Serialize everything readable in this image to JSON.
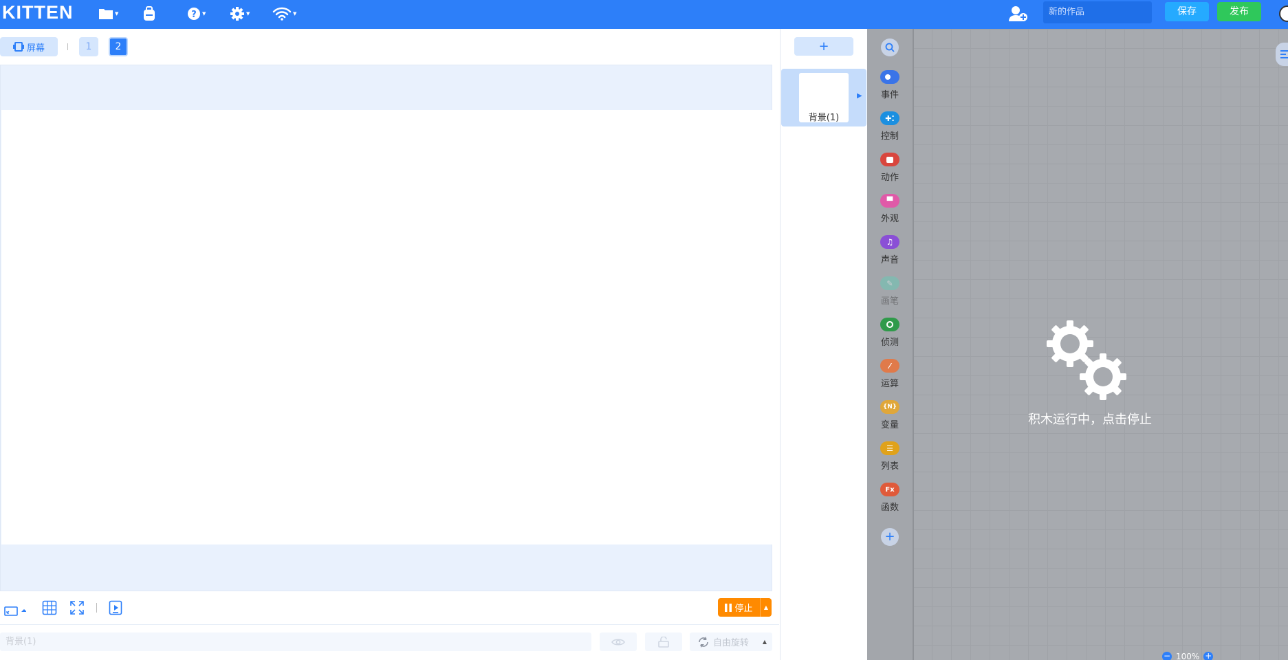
{
  "topbar": {
    "logo": "KITTEN",
    "menu_icons": [
      "file-icon",
      "backpack-icon",
      "help-icon",
      "settings-icon",
      "wifi-icon"
    ],
    "add_user_icon": "add-user-icon",
    "title_placeholder": "新的作品",
    "save_label": "保存",
    "publish_label": "发布"
  },
  "stage_header": {
    "screen_label": "屏幕",
    "pages": [
      "1",
      "2"
    ],
    "active_page": "2"
  },
  "stage_tools": {
    "stop_label": "停止",
    "icons": [
      "screen-size-icon",
      "grid-icon",
      "fullscreen-icon",
      "play-preview-icon"
    ]
  },
  "properties": {
    "name_placeholder": "背景(1)",
    "rotate_label": "自由旋转"
  },
  "sprites": {
    "add_label": "+",
    "items": [
      {
        "label": "背景(1)"
      }
    ]
  },
  "categories": [
    {
      "label": "事件",
      "color": "#3a74e8",
      "icon": "event-icon"
    },
    {
      "label": "控制",
      "color": "#1b8fe0",
      "icon": "gamepad-icon"
    },
    {
      "label": "动作",
      "color": "#d9463e",
      "icon": "robot-icon"
    },
    {
      "label": "外观",
      "color": "#e05aa8",
      "icon": "shirt-icon"
    },
    {
      "label": "声音",
      "color": "#8a4fd6",
      "icon": "music-icon"
    },
    {
      "label": "画笔",
      "color": "#5fcfb8",
      "icon": "pen-icon",
      "dim": true
    },
    {
      "label": "侦测",
      "color": "#2f9a4a",
      "icon": "sensor-icon"
    },
    {
      "label": "运算",
      "color": "#e07a4a",
      "icon": "operator-icon"
    },
    {
      "label": "变量",
      "color": "#e0a73a",
      "icon": "variable-icon"
    },
    {
      "label": "列表",
      "color": "#e0a21a",
      "icon": "list-icon"
    },
    {
      "label": "函数",
      "color": "#e05a3a",
      "icon": "function-icon"
    }
  ],
  "workspace": {
    "running_message": "积木运行中，点击停止",
    "zoom": "100%"
  }
}
